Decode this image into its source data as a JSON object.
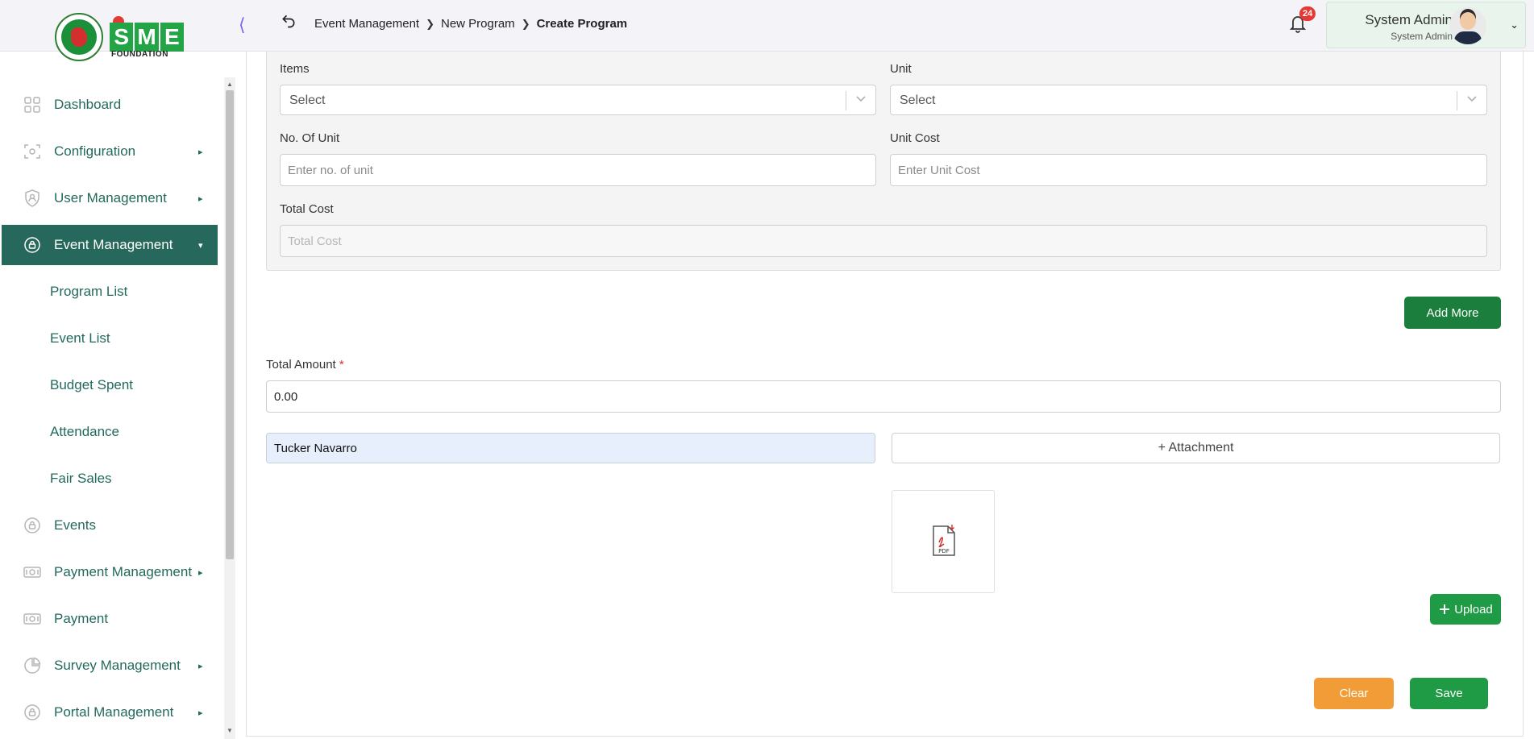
{
  "header": {
    "logo_text": "SME",
    "logo_subtext": "FOUNDATION",
    "breadcrumb": [
      "Event Management",
      "New Program",
      "Create Program"
    ],
    "notification_count": "24",
    "user_name": "System Admin",
    "user_role": "System Admin"
  },
  "sidebar": {
    "items": [
      {
        "label": "Dashboard"
      },
      {
        "label": "Configuration"
      },
      {
        "label": "User Management"
      },
      {
        "label": "Event Management"
      },
      {
        "label": "Events"
      },
      {
        "label": "Payment Management"
      },
      {
        "label": "Payment"
      },
      {
        "label": "Survey Management"
      },
      {
        "label": "Portal Management"
      }
    ],
    "sub_items": [
      {
        "label": "Program List"
      },
      {
        "label": "Event List"
      },
      {
        "label": "Budget Spent"
      },
      {
        "label": "Attendance"
      },
      {
        "label": "Fair Sales"
      }
    ]
  },
  "form": {
    "items_label": "Items",
    "items_value": "Select",
    "unit_label": "Unit",
    "unit_value": "Select",
    "no_of_unit_label": "No. Of Unit",
    "no_of_unit_placeholder": "Enter no. of unit",
    "unit_cost_label": "Unit Cost",
    "unit_cost_placeholder": "Enter Unit Cost",
    "total_cost_label": "Total Cost",
    "total_cost_placeholder": "Total Cost",
    "add_more_label": "Add More",
    "total_amount_label": "Total Amount",
    "total_amount_required": "*",
    "total_amount_value": "0.00",
    "attachment_name_value": "Tucker Navarro",
    "attachment_button_label": "+ Attachment",
    "upload_label": "Upload",
    "clear_label": "Clear",
    "save_label": "Save"
  },
  "colors": {
    "sidebar_active": "#27685c",
    "sidebar_text": "#22695c",
    "primary_green": "#1f9a45",
    "clear_orange": "#f29c38",
    "badge_red": "#e53935"
  }
}
